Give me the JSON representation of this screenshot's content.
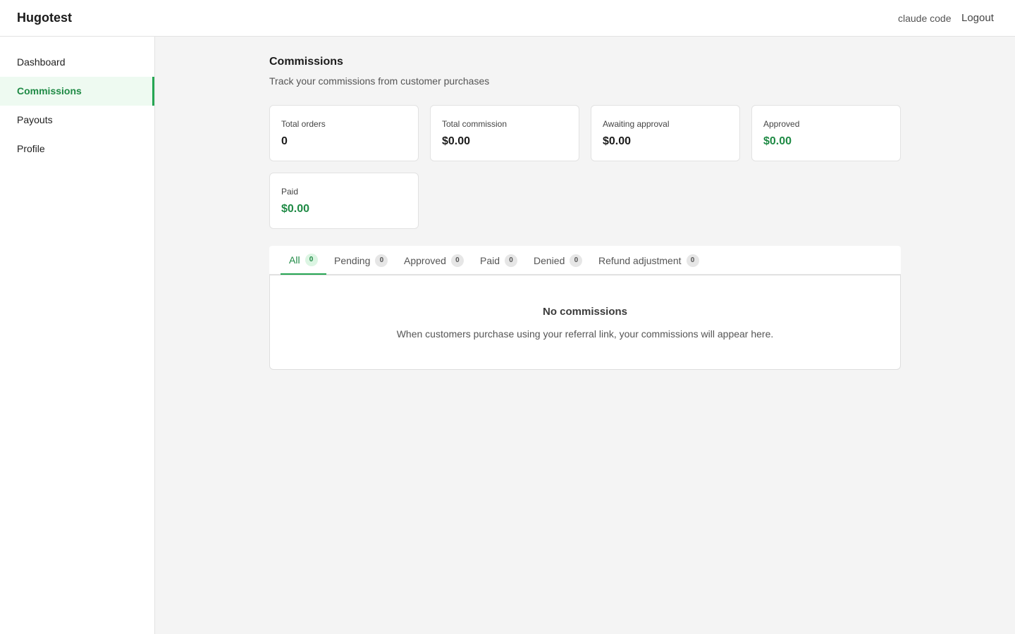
{
  "header": {
    "brand": "Hugotest",
    "user_name": "claude code",
    "logout_label": "Logout"
  },
  "sidebar": {
    "items": [
      {
        "label": "Dashboard",
        "active": false
      },
      {
        "label": "Commissions",
        "active": true
      },
      {
        "label": "Payouts",
        "active": false
      },
      {
        "label": "Profile",
        "active": false
      }
    ]
  },
  "page": {
    "title": "Commissions",
    "subtitle": "Track your commissions from customer purchases"
  },
  "stats": [
    {
      "label": "Total orders",
      "value": "0",
      "emphasis": "dark"
    },
    {
      "label": "Total commission",
      "value": "$0.00",
      "emphasis": "dark"
    },
    {
      "label": "Awaiting approval",
      "value": "$0.00",
      "emphasis": "dark"
    },
    {
      "label": "Approved",
      "value": "$0.00",
      "emphasis": "green"
    },
    {
      "label": "Paid",
      "value": "$0.00",
      "emphasis": "green"
    }
  ],
  "tabs": [
    {
      "label": "All",
      "count": "0",
      "active": true
    },
    {
      "label": "Pending",
      "count": "0",
      "active": false
    },
    {
      "label": "Approved",
      "count": "0",
      "active": false
    },
    {
      "label": "Paid",
      "count": "0",
      "active": false
    },
    {
      "label": "Denied",
      "count": "0",
      "active": false
    },
    {
      "label": "Refund adjustment",
      "count": "0",
      "active": false
    }
  ],
  "empty_state": {
    "title": "No commissions",
    "text": "When customers purchase using your referral link, your commissions will appear here."
  },
  "colors": {
    "accent": "#26a653",
    "accent_text": "#1f8a45",
    "active_nav_bg": "#eefaf1",
    "page_bg": "#f4f4f4"
  }
}
